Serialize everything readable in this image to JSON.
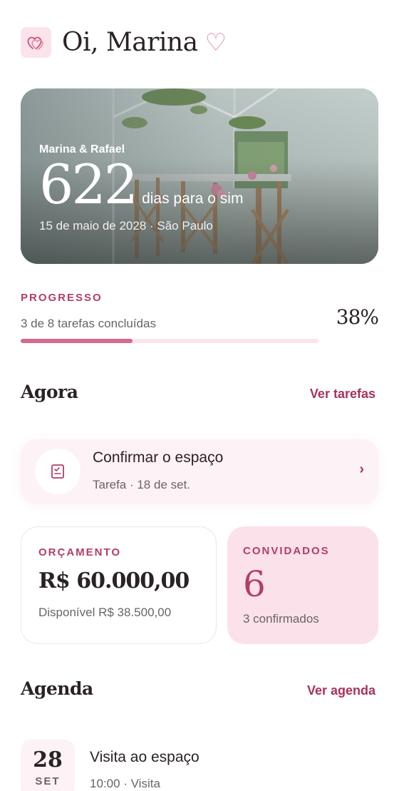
{
  "header": {
    "greeting": "Oi, Marina",
    "heart_glyph": "♡",
    "logo_icon": "interlocking-hearts-icon"
  },
  "hero": {
    "names": "Marina & Rafael",
    "days_count": "622",
    "days_label": "dias para o sim",
    "date_location": "15 de maio de 2028 · São Paulo"
  },
  "progress": {
    "label": "PROGRESSO",
    "description": "3 de 8 tarefas concluídas",
    "percent_text": "38%",
    "fraction": 0.375
  },
  "now_section": {
    "title": "Agora",
    "link": "Ver tarefas"
  },
  "task": {
    "title": "Confirmar o espaço",
    "subtitle": "Tarefa · 18 de set.",
    "chevron": "›",
    "icon": "checklist-icon"
  },
  "budget": {
    "label": "ORÇAMENTO",
    "value": "R$ 60.000,00",
    "available": "Disponível R$ 38.500,00"
  },
  "guests": {
    "label": "CONVIDADOS",
    "count": "6",
    "confirmed": "3 confirmados"
  },
  "agenda_section": {
    "title": "Agenda",
    "link": "Ver agenda"
  },
  "event": {
    "day": "28",
    "month": "SET",
    "title": "Visita ao espaço",
    "subtitle": "10:00 · Visita"
  },
  "colors": {
    "accent": "#b23e68",
    "accent_light": "#fbe1e9",
    "progress_fill": "#d46a90"
  }
}
